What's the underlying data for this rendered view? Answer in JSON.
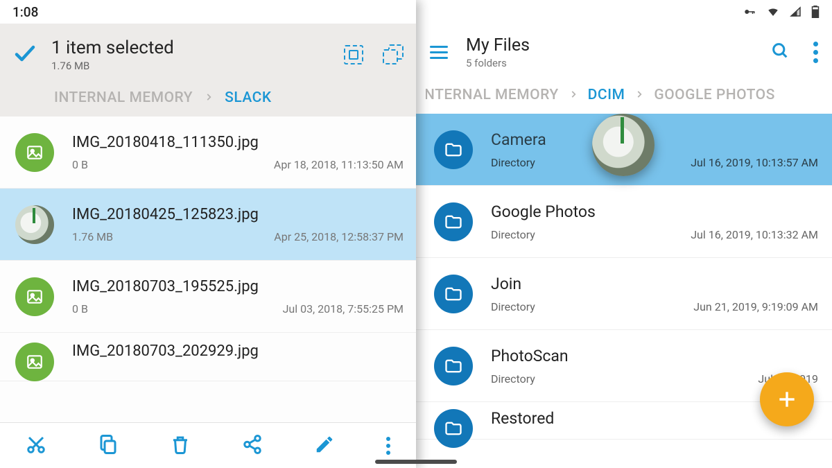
{
  "statusbar": {
    "time": "1:08"
  },
  "left": {
    "selection": {
      "title": "1 item selected",
      "size": "1.76 MB"
    },
    "breadcrumbs": {
      "root": "INTERNAL MEMORY",
      "current": "SLACK"
    },
    "files": [
      {
        "name": "IMG_20180418_111350.jpg",
        "size": "0 B",
        "date": "Apr 18, 2018, 11:13:50 AM",
        "selected": false
      },
      {
        "name": "IMG_20180425_125823.jpg",
        "size": "1.76 MB",
        "date": "Apr 25, 2018, 12:58:37 PM",
        "selected": true
      },
      {
        "name": "IMG_20180703_195525.jpg",
        "size": "0 B",
        "date": "Jul 03, 2018, 7:55:25 PM",
        "selected": false
      },
      {
        "name": "IMG_20180703_202929.jpg",
        "size": "",
        "date": "",
        "selected": false
      }
    ]
  },
  "right": {
    "header": {
      "title": "My Files",
      "subtitle": "5 folders"
    },
    "breadcrumbs": {
      "root": "NTERNAL MEMORY",
      "current": "DCIM",
      "next": "GOOGLE PHOTOS"
    },
    "dirs": [
      {
        "name": "Camera",
        "type": "Directory",
        "date": "Jul 16, 2019, 10:13:57 AM",
        "highlighted": true
      },
      {
        "name": "Google Photos",
        "type": "Directory",
        "date": "Jul 16, 2019, 10:13:32 AM",
        "highlighted": false
      },
      {
        "name": "Join",
        "type": "Directory",
        "date": "Jun 21, 2019, 9:19:09 AM",
        "highlighted": false
      },
      {
        "name": "PhotoScan",
        "type": "Directory",
        "date": "Jul 16, 2019",
        "highlighted": false
      },
      {
        "name": "Restored",
        "type": "",
        "date": "",
        "highlighted": false
      }
    ]
  }
}
